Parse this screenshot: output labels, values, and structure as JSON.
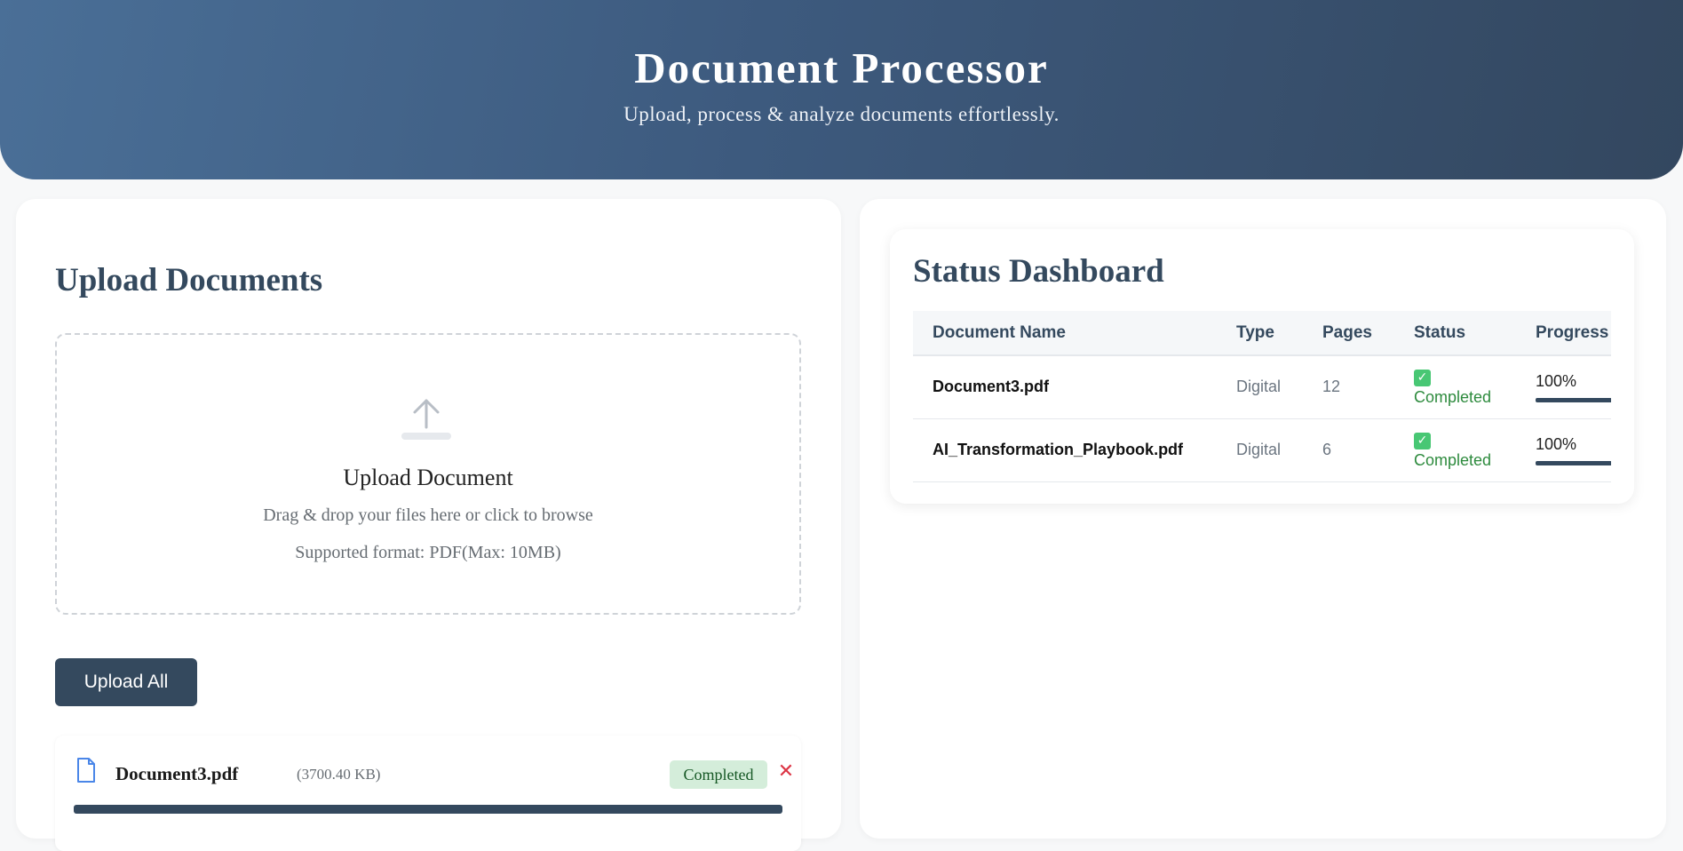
{
  "header": {
    "title": "Document Processor",
    "subtitle": "Upload, process & analyze documents effortlessly."
  },
  "upload": {
    "section_title": "Upload Documents",
    "dropzone": {
      "icon": "upload-arrow-icon",
      "title": "Upload Document",
      "hint": "Drag & drop your files here or click to browse",
      "format": "Supported format: PDF(Max: 10MB)"
    },
    "upload_all_label": "Upload All",
    "files": [
      {
        "icon": "file-icon",
        "name": "Document3.pdf",
        "size": "(3700.40 KB)",
        "status": "Completed",
        "remove_icon": "close-icon",
        "remove_glyph": "✕",
        "progress": 1.0
      }
    ]
  },
  "dashboard": {
    "section_title": "Status Dashboard",
    "columns": [
      "Document Name",
      "Type",
      "Pages",
      "Status",
      "Progress"
    ],
    "rows": [
      {
        "name": "Document3.pdf",
        "type": "Digital",
        "pages": "12",
        "status": "Completed",
        "progress": "100%"
      },
      {
        "name": "AI_Transformation_Playbook.pdf",
        "type": "Digital",
        "pages": "6",
        "status": "Completed",
        "progress": "100%"
      }
    ]
  },
  "colors": {
    "header_gradient_start": "#4a6f97",
    "header_gradient_end": "#33475f",
    "primary": "#34495e",
    "success_badge_bg": "#d4edda",
    "success_text": "#2e8b3e",
    "danger": "#dc3545"
  }
}
